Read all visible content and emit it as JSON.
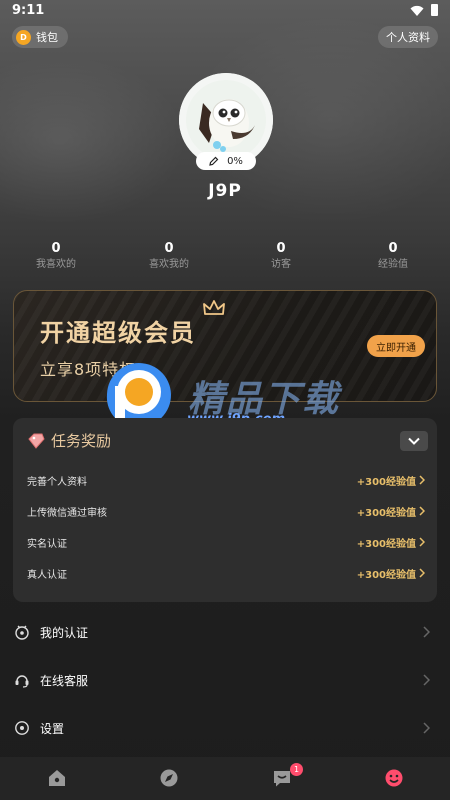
{
  "status_bar": {
    "time": "9:11"
  },
  "top": {
    "wallet_label": "钱包",
    "coin_glyph": "D",
    "profile_label": "个人资料"
  },
  "user": {
    "name": "J9P",
    "progress": "0%"
  },
  "stats": [
    {
      "value": "0",
      "label": "我喜欢的"
    },
    {
      "value": "0",
      "label": "喜欢我的"
    },
    {
      "value": "0",
      "label": "访客"
    },
    {
      "value": "0",
      "label": "经验值"
    }
  ],
  "vip": {
    "title": "开通超级会员",
    "subtitle": "立享8项特权",
    "button": "立即开通"
  },
  "watermark": {
    "text": "精品下载",
    "url": "www.j9p.com"
  },
  "tasks": {
    "title": "任务奖励",
    "items": [
      {
        "label": "完善个人资料",
        "reward": "+300经验值"
      },
      {
        "label": "上传微信通过审核",
        "reward": "+300经验值"
      },
      {
        "label": "实名认证",
        "reward": "+300经验值"
      },
      {
        "label": "真人认证",
        "reward": "+300经验值"
      }
    ]
  },
  "menu": [
    {
      "label": "我的认证",
      "icon": "certification-icon"
    },
    {
      "label": "在线客服",
      "icon": "headset-icon"
    },
    {
      "label": "设置",
      "icon": "settings-icon"
    }
  ],
  "bottom_nav": {
    "tabs": [
      "home-icon",
      "discover-icon",
      "message-icon",
      "profile-icon"
    ],
    "message_badge": "1",
    "active_color": "#ff4d6d"
  },
  "colors": {
    "accent_gold": "#f1a24a",
    "reward_gold": "#e8bf6a",
    "badge_red": "#ff4d6d"
  }
}
